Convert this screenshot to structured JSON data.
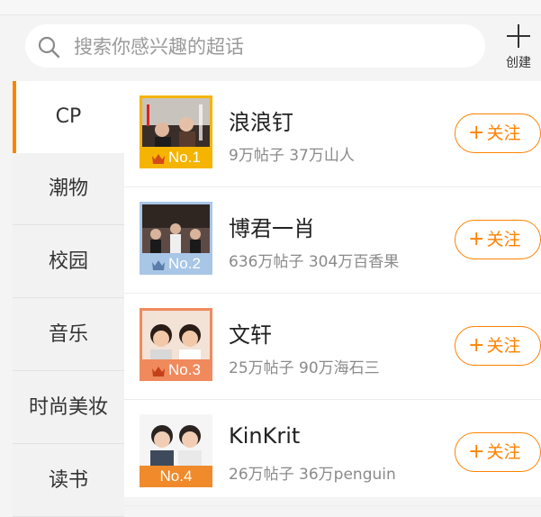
{
  "search": {
    "placeholder": "搜索你感兴趣的超话"
  },
  "create": {
    "label": "创建"
  },
  "sidebar": {
    "items": [
      {
        "label": "CP",
        "active": true
      },
      {
        "label": "潮物"
      },
      {
        "label": "校园"
      },
      {
        "label": "音乐"
      },
      {
        "label": "时尚美妆"
      },
      {
        "label": "读书"
      }
    ]
  },
  "list": {
    "follow_label": "关注",
    "items": [
      {
        "name": "浪浪钉",
        "stats": "9万帖子 37万山人",
        "rank": "No.1",
        "badge_color": "#f5b400"
      },
      {
        "name": "博君一肖",
        "stats": "636万帖子 304万百香果",
        "rank": "No.2",
        "badge_color": "#a8c6e6"
      },
      {
        "name": "文轩",
        "stats": "25万帖子 90万海石三",
        "rank": "No.3",
        "badge_color": "#f08a5d"
      },
      {
        "name": "KinKrit",
        "stats": "26万帖子 36万penguin",
        "rank": "No.4",
        "badge_color": "#f08a2a"
      }
    ]
  },
  "colors": {
    "accent": "#ff8200",
    "background": "#f4f4f4"
  }
}
